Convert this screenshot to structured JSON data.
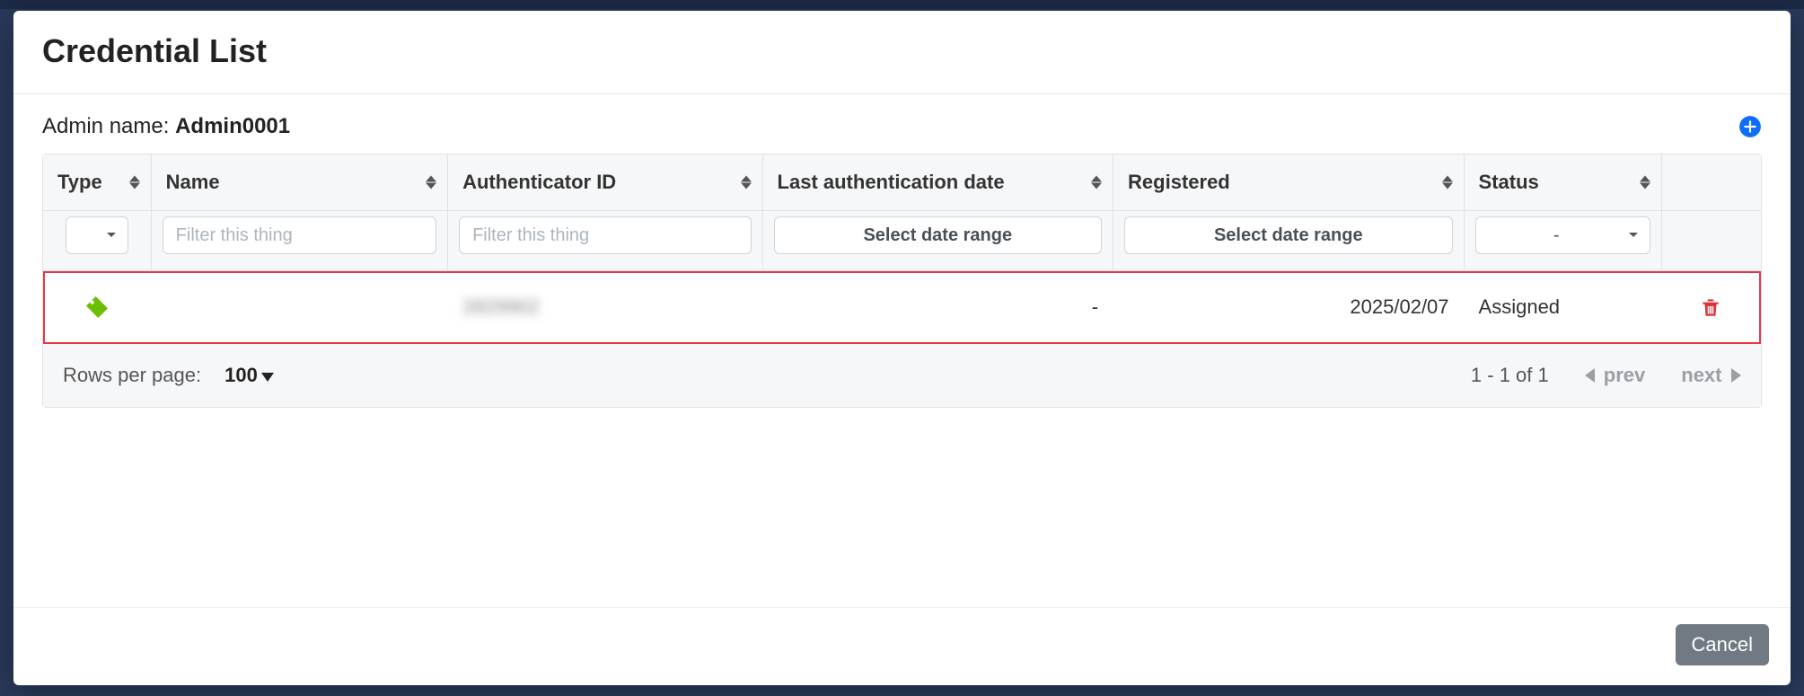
{
  "modal": {
    "title": "Credential List",
    "admin_label": "Admin name: ",
    "admin_name": "Admin0001",
    "add_icon": "plus-circle-icon"
  },
  "table": {
    "headers": {
      "type": "Type",
      "name": "Name",
      "auth_id": "Authenticator ID",
      "last_auth": "Last authentication date",
      "registered": "Registered",
      "status": "Status"
    },
    "filters": {
      "name_placeholder": "Filter this thing",
      "auth_placeholder": "Filter this thing",
      "last_auth_placeholder": "Select date range",
      "registered_placeholder": "Select date range",
      "status_value": "-"
    },
    "rows": [
      {
        "type_icon": "tag-icon",
        "name": "",
        "auth_id": "2829902",
        "last_auth": "-",
        "registered": "2025/02/07",
        "status": "Assigned",
        "action_icon": "trash-icon"
      }
    ]
  },
  "pager": {
    "rows_label": "Rows per page:",
    "rows_value": "100",
    "range": "1 - 1 of 1",
    "prev": "prev",
    "next": "next"
  },
  "footer": {
    "cancel": "Cancel"
  }
}
